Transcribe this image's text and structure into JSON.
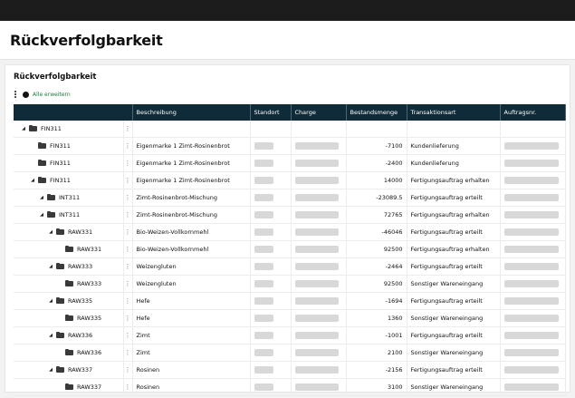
{
  "page": {
    "title": "Rückverfolgbarkeit"
  },
  "card": {
    "title": "Rückverfolgbarkeit",
    "expand_all_label": "Alle erweitern"
  },
  "table": {
    "columns": [
      "",
      "",
      "Beschreibung",
      "Standort",
      "Charge",
      "Bestandsmenge",
      "Transaktionsart",
      "Auftragsnr."
    ],
    "rows": [
      {
        "level": 0,
        "expandable": true,
        "id": "FIN311",
        "desc": "",
        "qty": "",
        "type": "",
        "has_placeholders": false
      },
      {
        "level": 1,
        "expandable": false,
        "id": "FIN311",
        "desc": "Eigenmarke 1 Zimt-Rosinenbrot",
        "qty": "-7100",
        "type": "Kundenlieferung",
        "has_placeholders": true
      },
      {
        "level": 1,
        "expandable": false,
        "id": "FIN311",
        "desc": "Eigenmarke 1 Zimt-Rosinenbrot",
        "qty": "-2400",
        "type": "Kundenlieferung",
        "has_placeholders": true
      },
      {
        "level": 1,
        "expandable": true,
        "id": "FIN311",
        "desc": "Eigenmarke 1 Zimt-Rosinenbrot",
        "qty": "14000",
        "type": "Fertigungsauftrag erhalten",
        "has_placeholders": true
      },
      {
        "level": 2,
        "expandable": true,
        "id": "INT311",
        "desc": "Zimt-Rosinenbrot-Mischung",
        "qty": "-23089.5",
        "type": "Fertigungsauftrag erteilt",
        "has_placeholders": true
      },
      {
        "level": 2,
        "expandable": true,
        "id": "INT311",
        "desc": "Zimt-Rosinenbrot-Mischung",
        "qty": "72765",
        "type": "Fertigungsauftrag erhalten",
        "has_placeholders": true
      },
      {
        "level": 3,
        "expandable": true,
        "id": "RAW331",
        "desc": "Bio-Weizen-Vollkornmehl",
        "qty": "-46046",
        "type": "Fertigungsauftrag erteilt",
        "has_placeholders": true
      },
      {
        "level": 4,
        "expandable": false,
        "id": "RAW331",
        "desc": "Bio-Weizen-Vollkornmehl",
        "qty": "92500",
        "type": "Fertigungsauftrag erhalten",
        "has_placeholders": true
      },
      {
        "level": 3,
        "expandable": true,
        "id": "RAW333",
        "desc": "Weizengluten",
        "qty": "-2464",
        "type": "Fertigungsauftrag erteilt",
        "has_placeholders": true
      },
      {
        "level": 4,
        "expandable": false,
        "id": "RAW333",
        "desc": "Weizengluten",
        "qty": "92500",
        "type": "Sonstiger Wareneingang",
        "has_placeholders": true
      },
      {
        "level": 3,
        "expandable": true,
        "id": "RAW335",
        "desc": "Hefe",
        "qty": "-1694",
        "type": "Fertigungsauftrag erteilt",
        "has_placeholders": true
      },
      {
        "level": 4,
        "expandable": false,
        "id": "RAW335",
        "desc": "Hefe",
        "qty": "1360",
        "type": "Sonstiger Wareneingang",
        "has_placeholders": true
      },
      {
        "level": 3,
        "expandable": true,
        "id": "RAW336",
        "desc": "Zimt",
        "qty": "-1001",
        "type": "Fertigungsauftrag erteilt",
        "has_placeholders": true
      },
      {
        "level": 4,
        "expandable": false,
        "id": "RAW336",
        "desc": "Zimt",
        "qty": "2100",
        "type": "Sonstiger Wareneingang",
        "has_placeholders": true
      },
      {
        "level": 3,
        "expandable": true,
        "id": "RAW337",
        "desc": "Rosinen",
        "qty": "-2156",
        "type": "Fertigungsauftrag erteilt",
        "has_placeholders": true
      },
      {
        "level": 4,
        "expandable": false,
        "id": "RAW337",
        "desc": "Rosinen",
        "qty": "3100",
        "type": "Sonstiger Wareneingang",
        "has_placeholders": true
      }
    ]
  },
  "icons": {
    "expanded": "triangle-down-icon",
    "row_item": "folder-icon",
    "menu": "kebab-icon"
  }
}
